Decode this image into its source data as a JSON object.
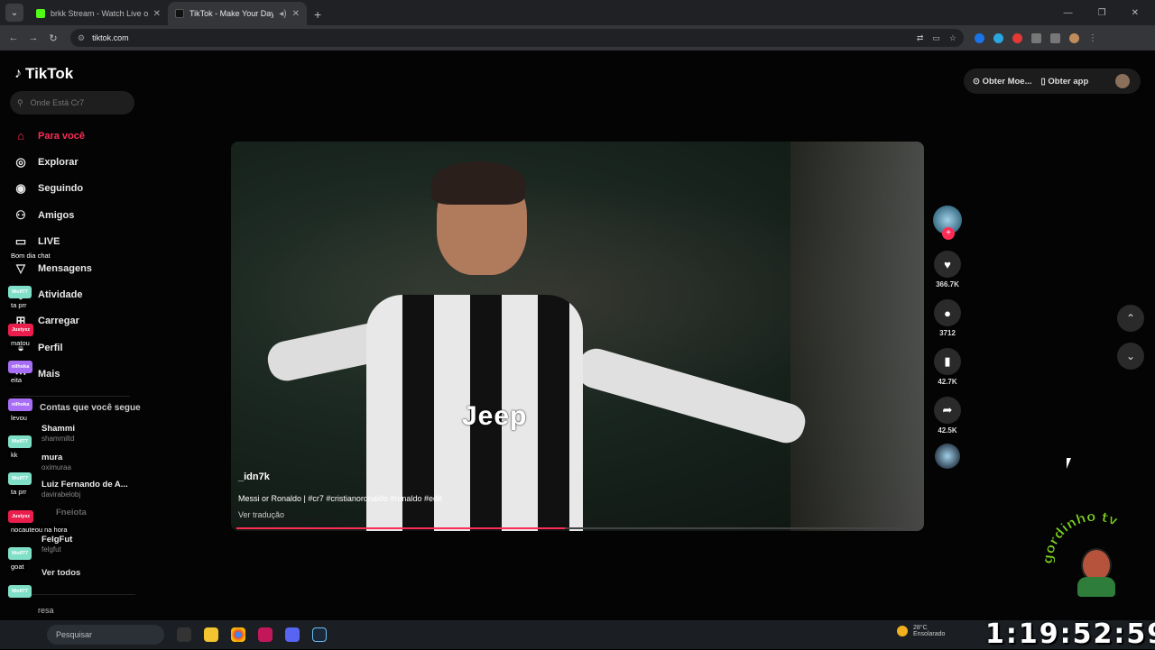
{
  "browser": {
    "tabs": [
      {
        "title": "brkk Stream - Watch Live o",
        "favicon_color": "#53fc18",
        "active": false
      },
      {
        "title": "TikTok - Make Your Day",
        "favicon_color": "#111111",
        "active": true
      }
    ],
    "new_tab": "+",
    "url": "tiktok.com"
  },
  "tiktok": {
    "logo": "TikTok",
    "search_placeholder": "Onde Está Cr7",
    "nav": [
      {
        "label": "Para você",
        "icon": "home-icon",
        "active": true
      },
      {
        "label": "Explorar",
        "icon": "compass-icon"
      },
      {
        "label": "Seguindo",
        "icon": "following-avatar-icon"
      },
      {
        "label": "Amigos",
        "icon": "friends-icon"
      },
      {
        "label": "LIVE",
        "icon": "live-icon"
      },
      {
        "label": "Mensagens",
        "icon": "messages-icon"
      },
      {
        "label": "Atividade",
        "icon": "activity-icon"
      },
      {
        "label": "Carregar",
        "icon": "upload-icon"
      },
      {
        "label": "Perfil",
        "icon": "profile-icon"
      },
      {
        "label": "Mais",
        "icon": "more-icon"
      }
    ],
    "following_header": "Contas que você segue",
    "accounts": [
      {
        "name": "Shammi",
        "handle": "shammiltd"
      },
      {
        "name": "mura",
        "handle": "oximuraa"
      },
      {
        "name": "Luiz Fernando de A...",
        "handle": "davirabelobj"
      },
      {
        "name": "Fneiota",
        "handle": ""
      },
      {
        "name": "FelgFut",
        "handle": "felgfut"
      }
    ],
    "see_all": "Ver todos",
    "company": "resa",
    "top_buttons": {
      "coins": "Obter Moe...",
      "app": "Obter app"
    },
    "video": {
      "username": "_idn7k",
      "description": "Messi or Ronaldo | #cr7 #cristianoronaldo #ronaldo #edit",
      "translate": "Ver tradução",
      "jersey_text": "Jeep",
      "progress": 0.48
    },
    "actions": {
      "likes": "366.7K",
      "comments": "3712",
      "saves": "42.7K",
      "shares": "42.5K"
    }
  },
  "chat": [
    {
      "user": "",
      "user_color": "#9147ff",
      "message": "Bom dia chat"
    },
    {
      "user": "Wolf77",
      "user_color": "#7fe0c7",
      "message": "ta prr"
    },
    {
      "user": "Justyxz",
      "user_color": "#e91e4d",
      "message": "matou"
    },
    {
      "user": "nilhoka",
      "user_color": "#a76ef5",
      "message": "eita"
    },
    {
      "user": "nilhoka",
      "user_color": "#a76ef5",
      "message": "levou"
    },
    {
      "user": "Wolf77",
      "user_color": "#7fe0c7",
      "message": "kk"
    },
    {
      "user": "Wolf77",
      "user_color": "#7fe0c7",
      "message": "ta prr"
    },
    {
      "user": "Justyxz",
      "user_color": "#e91e4d",
      "message": "nocauteou na hora"
    },
    {
      "user": "Wolf77",
      "user_color": "#7fe0c7",
      "message": "goat"
    },
    {
      "user": "Wolf77",
      "user_color": "#7fe0c7",
      "message": ""
    },
    {
      "user": "Justyxz",
      "user_color": "#e91e4d",
      "message": ""
    }
  ],
  "taskbar": {
    "search_placeholder": "Pesquisar",
    "weather_temp": "28°C",
    "weather_desc": "Ensolarado"
  },
  "overlay": {
    "clock": "1:19:52:59",
    "channel_logo_text": "gordinho tv"
  },
  "colors": {
    "accent": "#fe2c55",
    "background": "#000000"
  }
}
